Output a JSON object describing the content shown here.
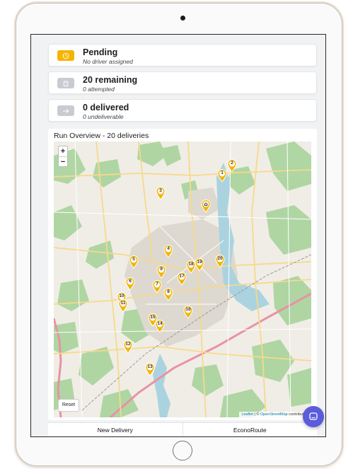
{
  "statuses": [
    {
      "title": "Pending",
      "sub": "No driver assigned",
      "color": "#f4b400",
      "icon": "clock-icon"
    },
    {
      "title": "20 remaining",
      "sub": "0 attempted",
      "color": "#c8ccd2",
      "icon": "box-icon"
    },
    {
      "title": "0 delivered",
      "sub": "0 undeliverable",
      "color": "#c8ccd2",
      "icon": "arrow-right-icon"
    }
  ],
  "overview": {
    "title": "Run Overview - 20 deliveries"
  },
  "map": {
    "zoom_in": "+",
    "zoom_out": "−",
    "reset": "Reset",
    "attribution_leaflet": "Leaflet",
    "attribution_sep": " | © ",
    "attribution_osm": "OpenStreetMap",
    "attribution_rest": " contributors",
    "home_icon": "home-icon",
    "pin_color": "#f4b400",
    "markers": [
      "1",
      "2",
      "3",
      "4",
      "5",
      "6",
      "7",
      "8",
      "9",
      "10",
      "11",
      "12",
      "13",
      "14",
      "15",
      "16",
      "17",
      "18",
      "19",
      "20"
    ]
  },
  "tabs": {
    "new_delivery": "New Delivery",
    "econoroute": "EconoRoute"
  },
  "chat": {
    "icon": "chat-icon",
    "color": "#5b5cdb"
  }
}
